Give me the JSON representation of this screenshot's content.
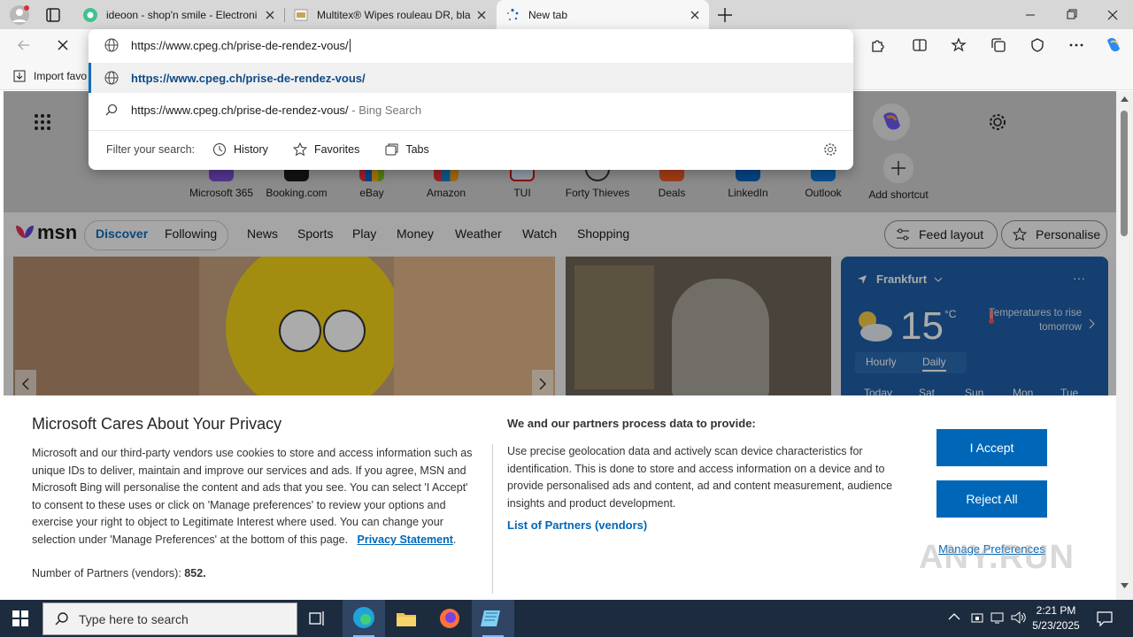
{
  "browser": {
    "tabs": [
      {
        "title": "ideoon - shop'n smile - Electroni",
        "active": false
      },
      {
        "title": "Multitex® Wipes rouleau DR, bla",
        "active": false
      },
      {
        "title": "New tab",
        "active": true
      }
    ],
    "address_bar": {
      "value": "https://www.cpeg.ch/prise-de-rendez-vous/"
    },
    "favorites_bar": {
      "import_label": "Import favo"
    }
  },
  "omnibox": {
    "suggestions": [
      {
        "text": "https://www.cpeg.ch/prise-de-rendez-vous/",
        "suffix": "",
        "icon": "globe-icon"
      },
      {
        "text": "https://www.cpeg.ch/prise-de-rendez-vous/",
        "suffix": " - Bing Search",
        "icon": "search-icon"
      }
    ],
    "filter_label": "Filter your search:",
    "filters": [
      "History",
      "Favorites",
      "Tabs"
    ]
  },
  "new_tab": {
    "shortcuts": [
      {
        "label": "Microsoft 365",
        "color": "#7b4fd6"
      },
      {
        "label": "Booking.com",
        "color": "#1a1a1a"
      },
      {
        "label": "eBay",
        "color": "#e53238"
      },
      {
        "label": "Amazon",
        "color": "#f29b18"
      },
      {
        "label": "TUI",
        "color": "#d40e14"
      },
      {
        "label": "Forty Thieves",
        "color": "#333333"
      },
      {
        "label": "Deals",
        "color": "#f05a23"
      },
      {
        "label": "LinkedIn",
        "color": "#0a66c2"
      },
      {
        "label": "Outlook",
        "color": "#0f78d4"
      },
      {
        "label": "Add shortcut",
        "color": "#666666"
      }
    ],
    "msn": {
      "logo": "msn",
      "tabs": [
        "Discover",
        "Following"
      ],
      "nav": [
        "News",
        "Sports",
        "Play",
        "Money",
        "Weather",
        "Watch",
        "Shopping"
      ],
      "feed_layout": "Feed layout",
      "personalise": "Personalise"
    },
    "weather": {
      "city": "Frankfurt",
      "temp": "15",
      "unit": "°C",
      "note": "Temperatures to rise tomorrow",
      "toggle": [
        "Hourly",
        "Daily"
      ],
      "days": [
        "Today",
        "Sat",
        "Sun",
        "Mon",
        "Tue"
      ]
    }
  },
  "privacy": {
    "title": "Microsoft Cares About Your Privacy",
    "body": "Microsoft and our third-party vendors use cookies to store and access information such as unique IDs to deliver, maintain and improve our services and ads. If you agree, MSN and Microsoft Bing will personalise the content and ads that you see. You can select 'I Accept' to consent to these uses or click on 'Manage preferences' to review your options and exercise your right to object to Legitimate Interest where used.  You can change your selection under 'Manage Preferences' at the bottom of this page.",
    "privacy_link": "Privacy Statement",
    "partners_prefix": "Number of Partners (vendors): ",
    "partners_count": "852.",
    "right_title": "We and our partners process data to provide:",
    "right_body": "Use precise geolocation data and actively scan device characteristics for identification. This is done to store and access information on a device and to provide personalised ads and content, ad and content measurement, audience insights and product development.",
    "partners_link": "List of Partners (vendors)",
    "accept": "I Accept",
    "reject": "Reject All",
    "manage": "Manage Preferences"
  },
  "taskbar": {
    "search_placeholder": "Type here to search",
    "time": "2:21 PM",
    "date": "5/23/2025"
  },
  "watermark": "ANY.RUN"
}
